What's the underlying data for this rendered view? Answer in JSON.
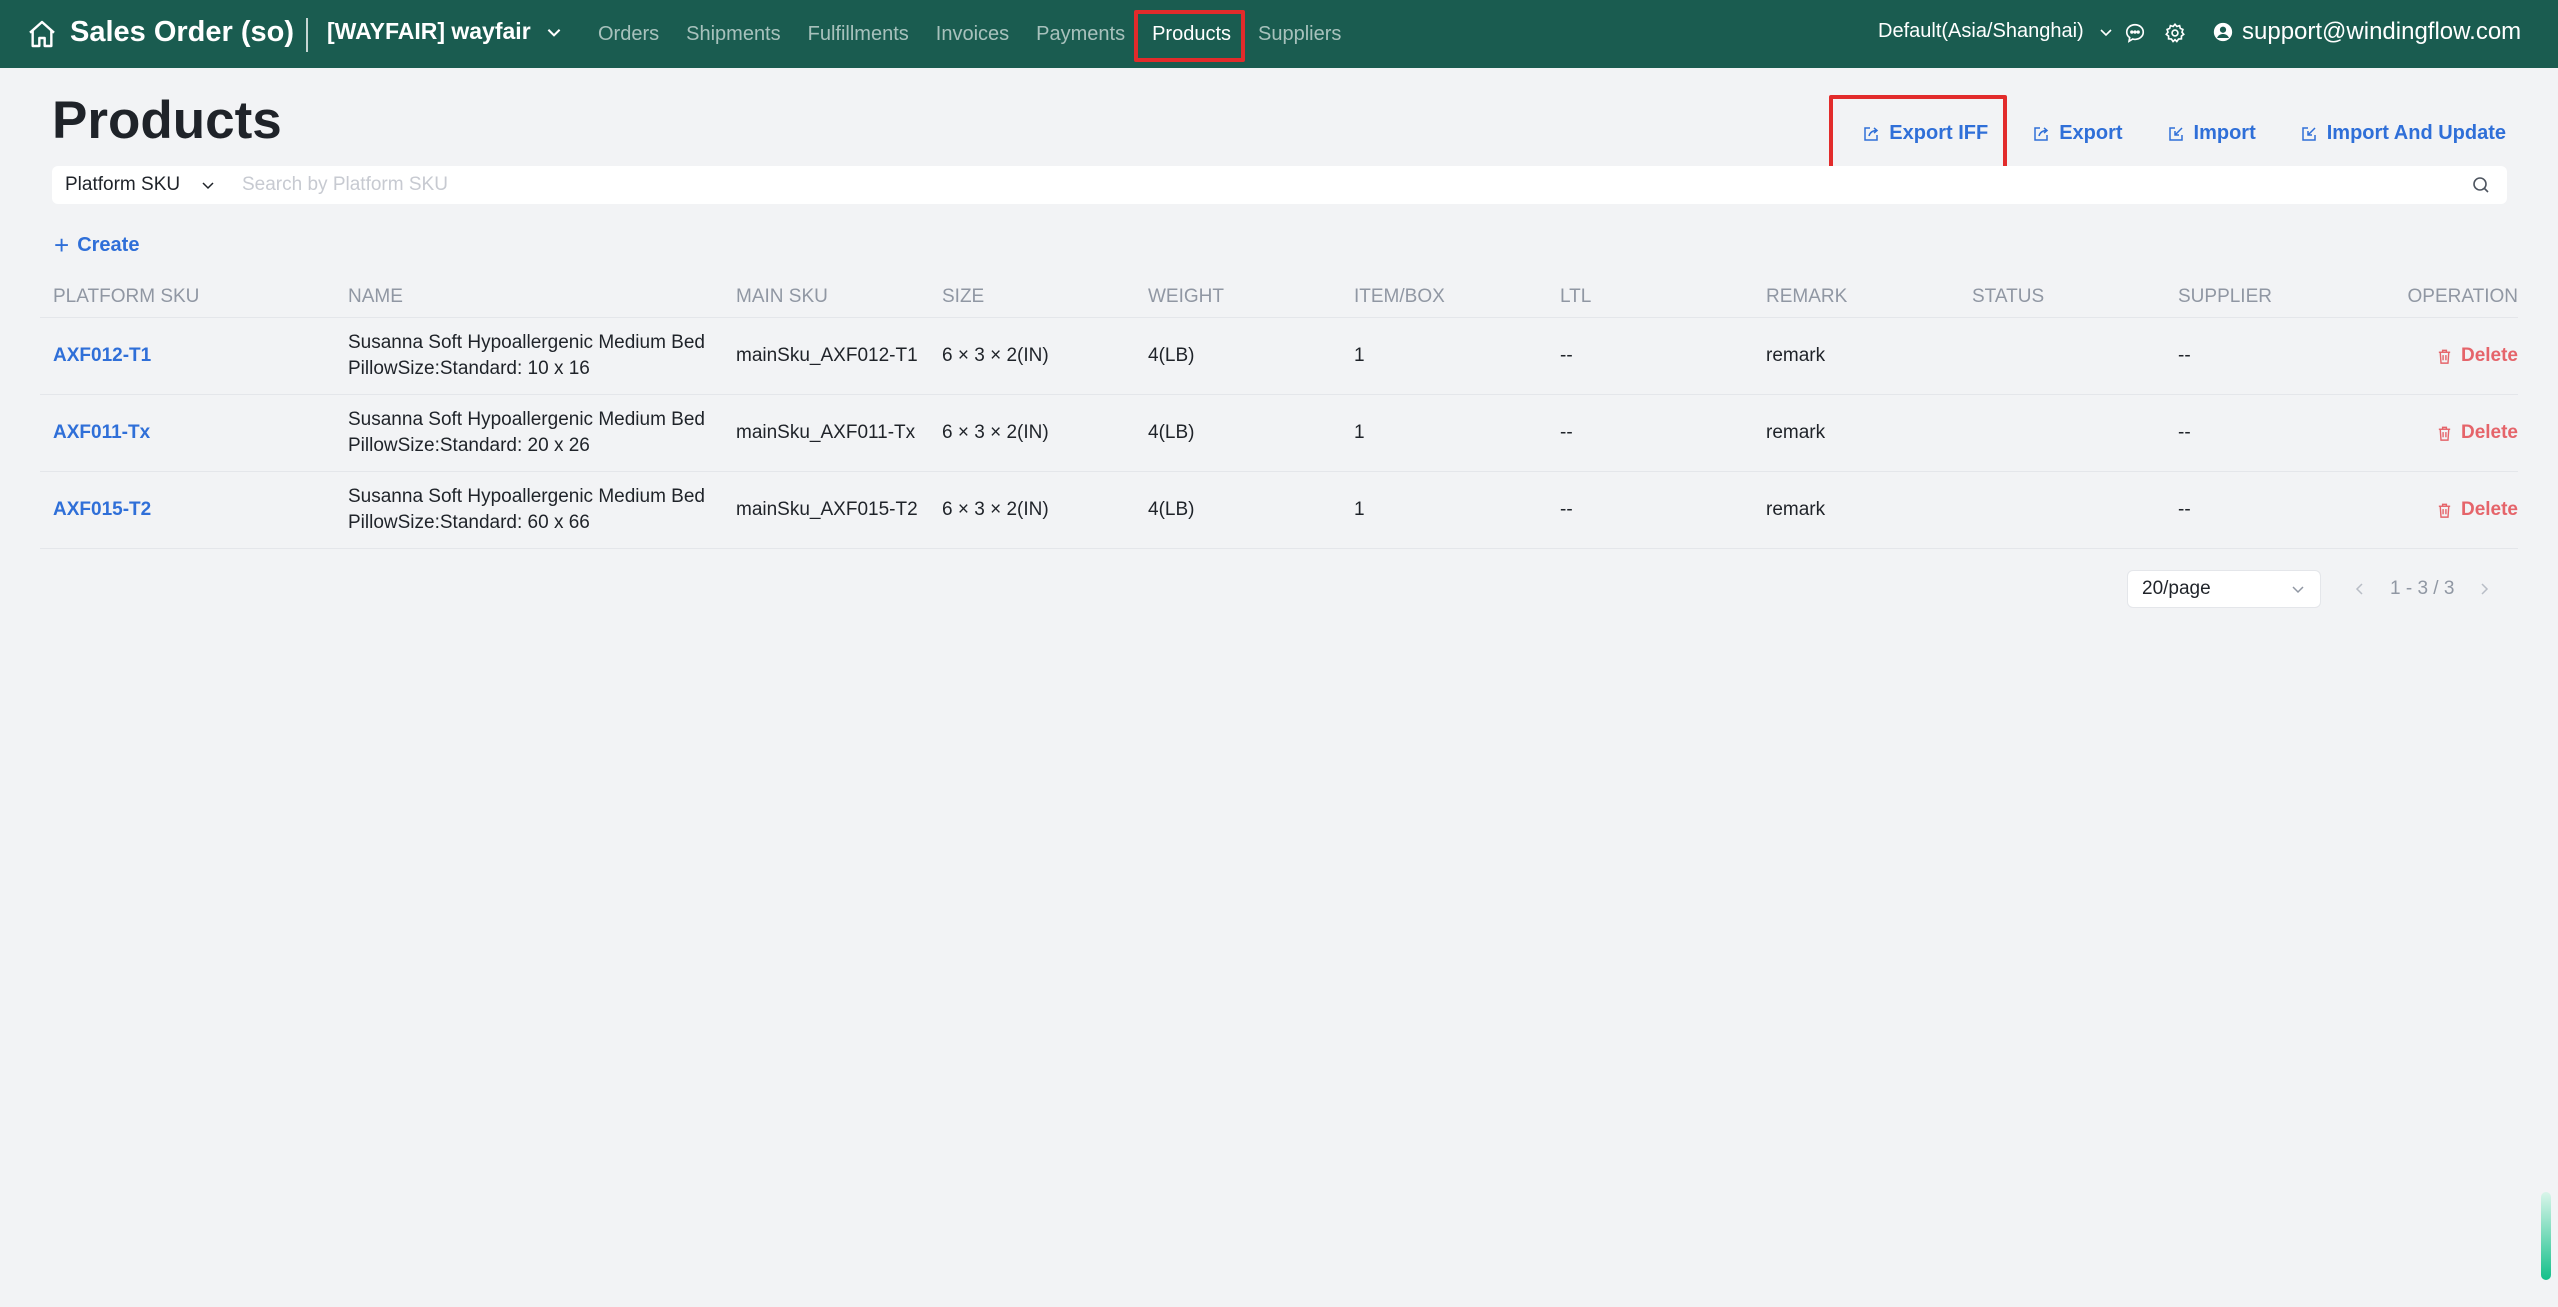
{
  "header": {
    "app_title": "Sales Order (so)",
    "store": "[WAYFAIR] wayfair",
    "nav": [
      {
        "label": "Orders"
      },
      {
        "label": "Shipments"
      },
      {
        "label": "Fulfillments"
      },
      {
        "label": "Invoices"
      },
      {
        "label": "Payments"
      },
      {
        "label": "Products"
      },
      {
        "label": "Suppliers"
      }
    ],
    "active_nav": "Products",
    "timezone": "Default(Asia/Shanghai)",
    "user_email": "support@windingflow.com"
  },
  "page": {
    "title": "Products"
  },
  "actions": {
    "export_iff": "Export IFF",
    "export": "Export",
    "import": "Import",
    "import_update": "Import And Update"
  },
  "search": {
    "field": "Platform SKU",
    "placeholder": "Search by Platform SKU",
    "value": ""
  },
  "create_label": "Create",
  "table": {
    "columns": [
      "PLATFORM SKU",
      "NAME",
      "MAIN SKU",
      "SIZE",
      "WEIGHT",
      "ITEM/BOX",
      "LTL",
      "REMARK",
      "STATUS",
      "SUPPLIER",
      "OPERATION"
    ],
    "rows": [
      {
        "platform_sku": "AXF012-T1",
        "name": "Susanna Soft Hypoallergenic Medium Bed PillowSize:Standard: 10 x 16",
        "main_sku": "mainSku_AXF012-T1",
        "size": "6 × 3 × 2(IN)",
        "weight": "4(LB)",
        "item_box": "1",
        "ltl": "--",
        "remark": "remark",
        "status": "",
        "supplier": "--",
        "operation": "Delete"
      },
      {
        "platform_sku": "AXF011-Tx",
        "name": "Susanna Soft Hypoallergenic Medium Bed PillowSize:Standard: 20 x 26",
        "main_sku": "mainSku_AXF011-Tx",
        "size": "6 × 3 × 2(IN)",
        "weight": "4(LB)",
        "item_box": "1",
        "ltl": "--",
        "remark": "remark",
        "status": "",
        "supplier": "--",
        "operation": "Delete"
      },
      {
        "platform_sku": "AXF015-T2",
        "name": "Susanna Soft Hypoallergenic Medium Bed PillowSize:Standard: 60 x 66",
        "main_sku": "mainSku_AXF015-T2",
        "size": "6 × 3 × 2(IN)",
        "weight": "4(LB)",
        "item_box": "1",
        "ltl": "--",
        "remark": "remark",
        "status": "",
        "supplier": "--",
        "operation": "Delete"
      }
    ]
  },
  "pagination": {
    "page_size": "20/page",
    "range": "1 - 3 / 3"
  },
  "colors": {
    "topbar": "#1a5c50",
    "link": "#2f6fd8",
    "danger": "#e5646a",
    "highlight": "#e22b2b"
  }
}
